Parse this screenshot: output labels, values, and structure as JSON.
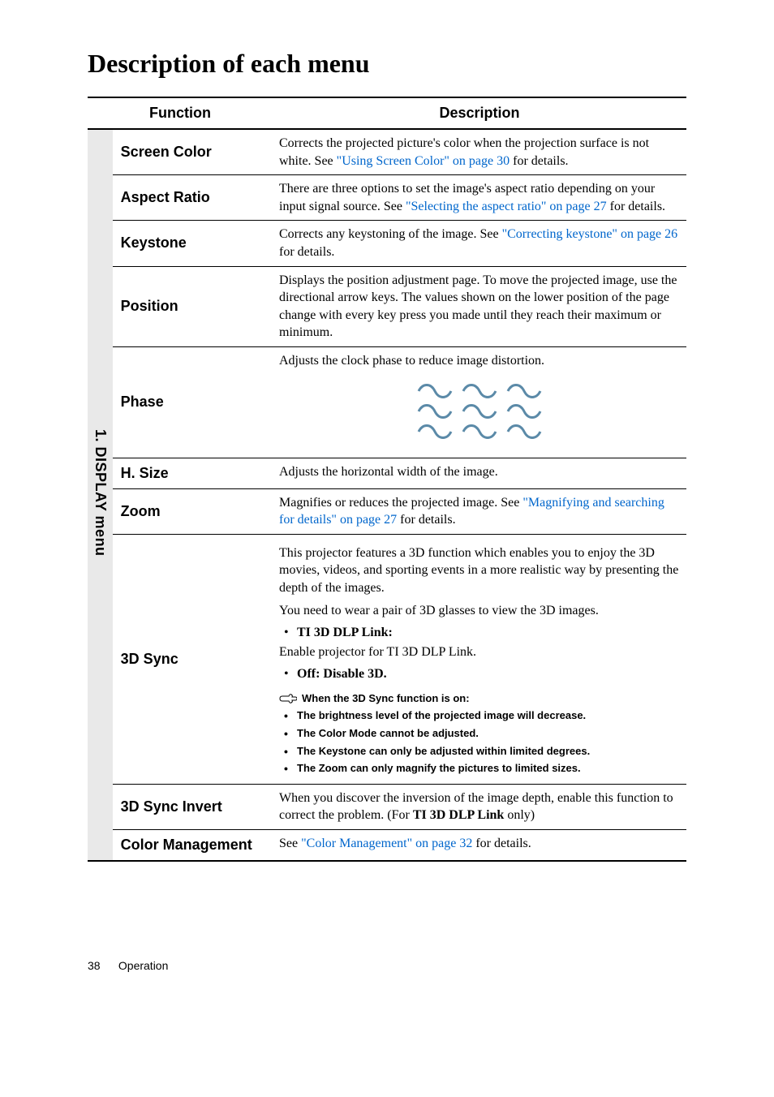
{
  "heading": "Description of each menu",
  "table_headers": {
    "function": "Function",
    "description": "Description"
  },
  "side_tab": "1. DISPLAY menu",
  "rows": {
    "screen_color": {
      "label": "Screen Color",
      "desc1": "Corrects the projected picture's color when the projection surface is not white. See ",
      "link": "\"Using Screen Color\" on page 30",
      "desc2": " for details."
    },
    "aspect_ratio": {
      "label": "Aspect Ratio",
      "desc1": "There are three options to set the image's aspect ratio depending on your input signal source. See ",
      "link": "\"Selecting the aspect ratio\" on page 27",
      "desc2": " for details."
    },
    "keystone": {
      "label": "Keystone",
      "desc1": "Corrects any keystoning of the image. See ",
      "link": "\"Correcting keystone\" on page 26",
      "desc2": " for details."
    },
    "position": {
      "label": "Position",
      "desc": "Displays the position adjustment page. To move the projected image, use the directional arrow keys. The values shown on the lower position of the page change with every key press you made until they reach their maximum or minimum."
    },
    "phase": {
      "label": "Phase",
      "desc": "Adjusts the clock phase to reduce image distortion."
    },
    "h_size": {
      "label": "H. Size",
      "desc": "Adjusts the horizontal width of the image."
    },
    "zoom": {
      "label": "Zoom",
      "desc1": "Magnifies or reduces the projected image. See ",
      "link": "\"Magnifying and searching for details\" on page 27",
      "desc2": " for details."
    },
    "sync3d": {
      "label": "3D Sync",
      "p1": "This projector features a 3D function which enables you to enjoy the 3D movies, videos, and sporting events in a more realistic way by presenting the depth of the images.",
      "p2": "You need to wear a pair of 3D glasses to view the 3D images.",
      "b1_label": "TI 3D DLP Link:",
      "b1_text": "Enable projector for TI 3D DLP Link.",
      "b2_label": "Off: Disable 3D.",
      "note_head": "When the 3D Sync function is on:",
      "n1": "The brightness level of the projected image will decrease.",
      "n2": "The Color Mode cannot be adjusted.",
      "n3": "The Keystone can only be adjusted within limited degrees.",
      "n4": "The Zoom can only magnify the pictures to limited sizes."
    },
    "sync3d_invert": {
      "label": "3D Sync Invert",
      "desc1": "When you discover the inversion of the image depth, enable this function to correct the problem. (For ",
      "bold": "TI 3D DLP Link",
      "desc2": " only)"
    },
    "color_mgmt": {
      "label": "Color Management",
      "desc1": "See ",
      "link": "\"Color Management\" on page 32",
      "desc2": " for details."
    }
  },
  "footer": {
    "page": "38",
    "section": "Operation"
  }
}
